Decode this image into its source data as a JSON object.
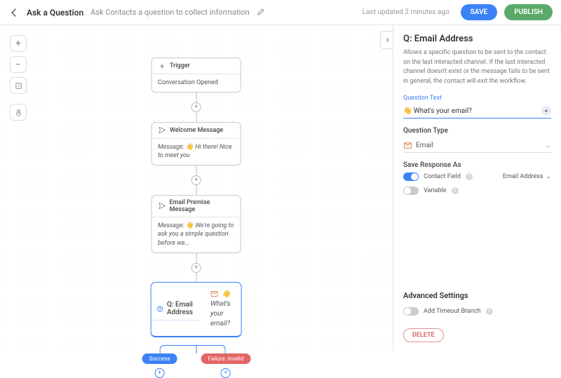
{
  "header": {
    "title": "Ask a Question",
    "subtitle": "Ask Contacts a question to collect information",
    "updated": "Last updated 2 minutes ago",
    "save": "SAVE",
    "publish": "PUBLISH"
  },
  "nodes": {
    "trigger": {
      "title": "Trigger",
      "body": "Conversation Opened"
    },
    "welcome": {
      "title": "Welcome Message",
      "body": "Message: 👋 Hi there! Nice to meet you"
    },
    "premise": {
      "title": "Email Premise Message",
      "body": "Message: 👋 We're going to ask you a simple question before we..."
    },
    "question": {
      "title": "Q: Email Address",
      "body": "👋 What's your email?"
    }
  },
  "branches": {
    "success": "Success",
    "failure": "Failure: invalid"
  },
  "panel": {
    "title": "Q: Email Address",
    "desc": "Allows a specific question to be sent to the contact on the last interacted channel. If the last interacted channel doesn't exist or the message fails to be sent in general, the contact will exit the workflow.",
    "qtext_label": "Question Text",
    "qtext_value": "👋 What's your email?",
    "qtype_label": "Question Type",
    "qtype_value": "Email",
    "save_as_label": "Save Response As",
    "contact_field": "Contact Field",
    "contact_field_value": "Email Address",
    "variable": "Variable",
    "advanced": "Advanced Settings",
    "timeout": "Add Timeout Branch",
    "delete": "DELETE"
  }
}
